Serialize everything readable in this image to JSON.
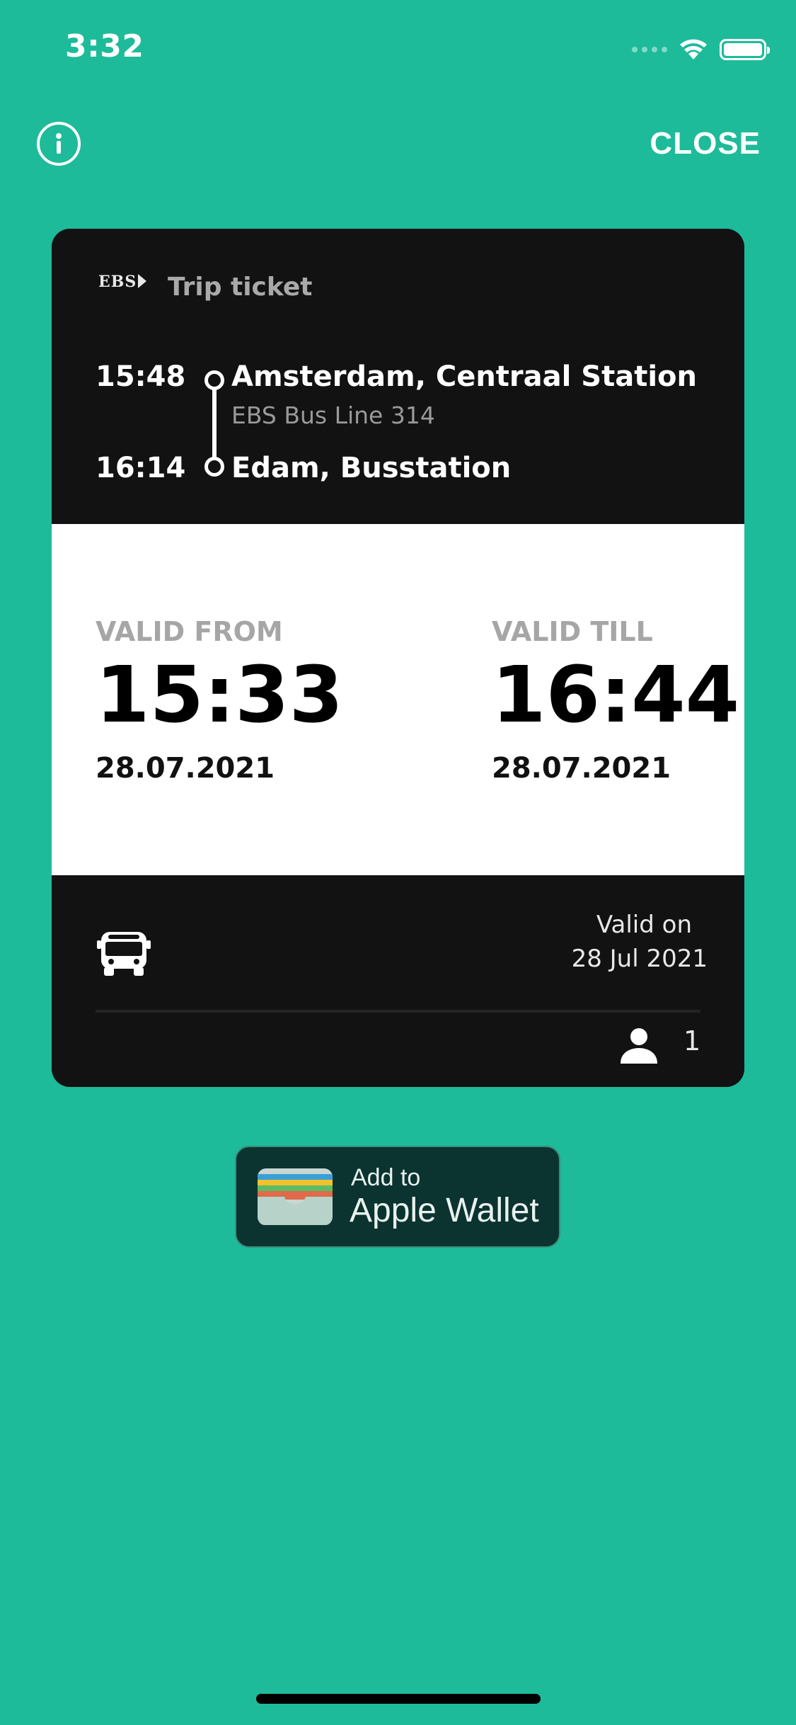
{
  "status_bar": {
    "time": "3:32"
  },
  "nav": {
    "close_label": "CLOSE"
  },
  "ticket": {
    "logo_text": "EBS",
    "type": "Trip ticket",
    "departure": {
      "time": "15:48",
      "station": "Amsterdam, Centraal Station"
    },
    "line": "EBS Bus Line 314",
    "arrival": {
      "time": "16:14",
      "station": "Edam, Busstation"
    },
    "valid_from": {
      "label": "VALID FROM",
      "time": "15:33",
      "date": "28.07.2021"
    },
    "valid_till": {
      "label": "VALID TILL",
      "time": "16:44",
      "date": "28.07.2021"
    },
    "valid_on": {
      "label": "Valid on",
      "date": "28 Jul 2021"
    },
    "passenger_count": "1"
  },
  "wallet_button": {
    "line1": "Add to",
    "line2": "Apple Wallet"
  },
  "colors": {
    "background": "#1dbb9a",
    "card_dark": "#121212",
    "card_light": "#ffffff"
  },
  "icons": [
    "info-icon",
    "bus-icon",
    "person-icon",
    "wallet-icon",
    "wifi-icon",
    "battery-icon"
  ]
}
